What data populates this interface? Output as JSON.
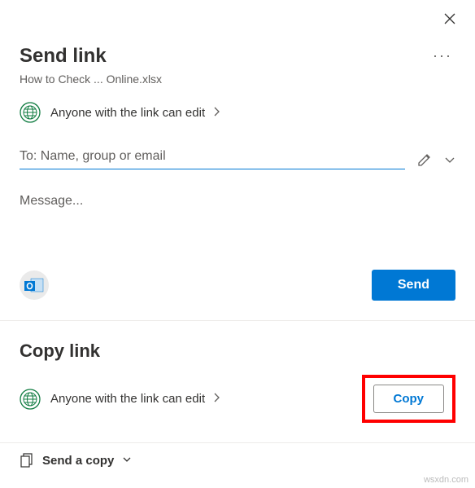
{
  "header": {
    "title": "Send link",
    "filename": "How to Check ... Online.xlsx"
  },
  "permissions": {
    "label": "Anyone with the link can edit"
  },
  "recipients": {
    "placeholder": "To: Name, group or email"
  },
  "message": {
    "placeholder": "Message..."
  },
  "actions": {
    "send_label": "Send"
  },
  "copy_link": {
    "title": "Copy link",
    "permission_label": "Anyone with the link can edit",
    "copy_button_label": "Copy"
  },
  "send_copy": {
    "label": "Send a copy"
  },
  "watermark": "wsxdn.com"
}
